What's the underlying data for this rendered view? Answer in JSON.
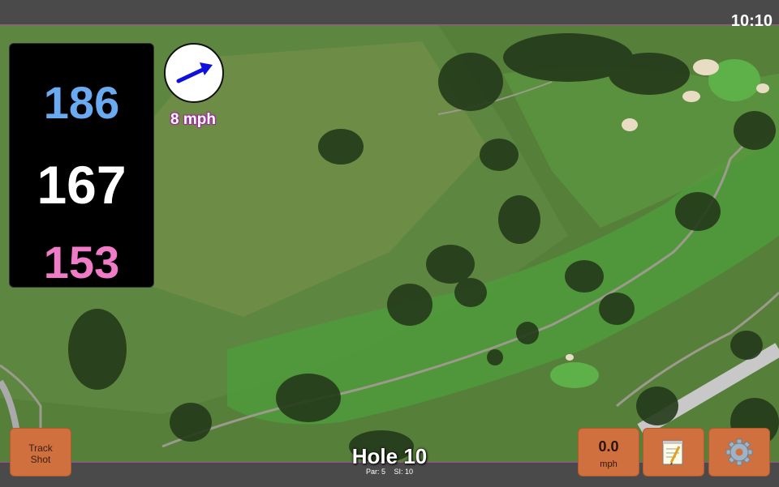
{
  "status_bar": {
    "clock": "10:10"
  },
  "distances": {
    "back": "186",
    "center": "167",
    "front": "153"
  },
  "wind": {
    "speed_label": "8 mph",
    "icon": "wind-direction-arrow-icon"
  },
  "buttons": {
    "track_shot_line1": "Track",
    "track_shot_line2": "Shot",
    "speed_value": "0.0",
    "speed_unit": "mph",
    "notes_icon": "notepad-icon",
    "settings_icon": "gear-icon"
  },
  "hole": {
    "title": "Hole 10",
    "par": "Par: 5",
    "si": "SI: 10"
  },
  "colors": {
    "back": "#6aaaf0",
    "center": "#ffffff",
    "front": "#f07cc8",
    "accent": "#a64aa6",
    "button": "#d0703e"
  }
}
